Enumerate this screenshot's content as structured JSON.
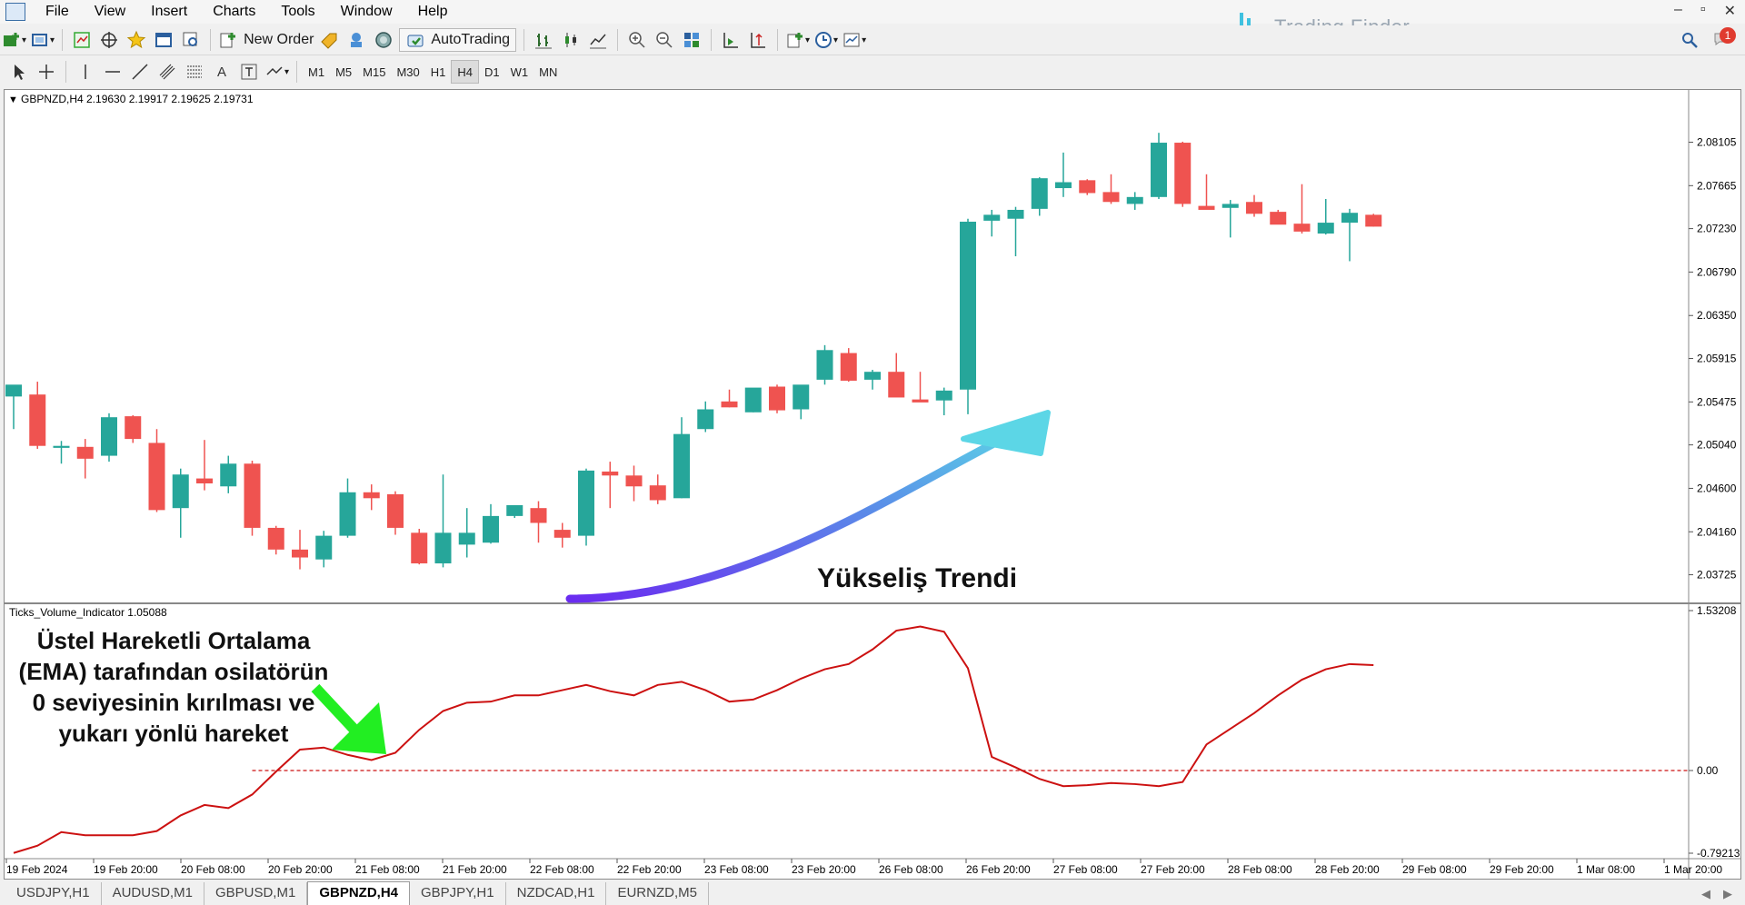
{
  "menu": [
    "File",
    "View",
    "Insert",
    "Charts",
    "Tools",
    "Window",
    "Help"
  ],
  "brand": {
    "name": "Trading Finder",
    "accent": "#3fc1e0"
  },
  "window_controls": [
    "–",
    "▫",
    "✕"
  ],
  "toolbar": {
    "new_order": "New Order",
    "autotrading": "AutoTrading",
    "timeframes": [
      "M1",
      "M5",
      "M15",
      "M30",
      "H1",
      "H4",
      "D1",
      "W1",
      "MN"
    ],
    "active_timeframe": "H4",
    "notification_count": "1"
  },
  "chart": {
    "header": "GBPNZD,H4  2.19630 2.19917 2.19625 2.19731",
    "indicator_header": "Ticks_Volume_Indicator 1.05088",
    "price_labels": [
      "2.08105",
      "2.07665",
      "2.07230",
      "2.06790",
      "2.06350",
      "2.05915",
      "2.05475",
      "2.05040",
      "2.04600",
      "2.04160",
      "2.03725"
    ],
    "indicator_labels": [
      "1.53208",
      "0.00",
      "-0.79213"
    ],
    "time_labels": [
      "19 Feb 2024",
      "19 Feb 20:00",
      "20 Feb 08:00",
      "20 Feb 20:00",
      "21 Feb 08:00",
      "21 Feb 20:00",
      "22 Feb 08:00",
      "22 Feb 20:00",
      "23 Feb 08:00",
      "23 Feb 20:00",
      "26 Feb 08:00",
      "26 Feb 20:00",
      "27 Feb 08:00",
      "27 Feb 20:00",
      "28 Feb 08:00",
      "28 Feb 20:00",
      "29 Feb 08:00",
      "29 Feb 20:00",
      "1 Mar 08:00",
      "1 Mar 20:00"
    ],
    "trend_label": "Yükseliş Trendi",
    "annotation_lines": [
      "Üstel Hareketli Ortalama",
      "(EMA) tarafından osilatörün",
      "0 seviyesinin kırılması ve",
      "yukarı yönlü hareket"
    ],
    "colors": {
      "bull": "#26a69a",
      "bear": "#ef5350",
      "indicator": "#cc1111",
      "zero_line": "#cc1111",
      "arrow_green": "#22ee22"
    }
  },
  "chart_data": [
    {
      "type": "candlestick",
      "symbol": "GBPNZD,H4",
      "ylim": [
        2.035,
        2.0845
      ],
      "candles": [
        {
          "o": 2.0553,
          "h": 2.0562,
          "l": 2.052,
          "c": 2.0565
        },
        {
          "o": 2.0555,
          "h": 2.0568,
          "l": 2.05,
          "c": 2.0503
        },
        {
          "o": 2.0501,
          "h": 2.0508,
          "l": 2.0485,
          "c": 2.0503
        },
        {
          "o": 2.0502,
          "h": 2.051,
          "l": 2.047,
          "c": 2.049
        },
        {
          "o": 2.0493,
          "h": 2.0536,
          "l": 2.0487,
          "c": 2.0532
        },
        {
          "o": 2.0533,
          "h": 2.0534,
          "l": 2.0506,
          "c": 2.051
        },
        {
          "o": 2.0506,
          "h": 2.052,
          "l": 2.0436,
          "c": 2.0438
        },
        {
          "o": 2.044,
          "h": 2.048,
          "l": 2.041,
          "c": 2.0474
        },
        {
          "o": 2.047,
          "h": 2.0509,
          "l": 2.0458,
          "c": 2.0465
        },
        {
          "o": 2.0462,
          "h": 2.0493,
          "l": 2.0455,
          "c": 2.0485
        },
        {
          "o": 2.0485,
          "h": 2.0488,
          "l": 2.0412,
          "c": 2.042
        },
        {
          "o": 2.042,
          "h": 2.0422,
          "l": 2.0393,
          "c": 2.0398
        },
        {
          "o": 2.0398,
          "h": 2.0418,
          "l": 2.0378,
          "c": 2.039
        },
        {
          "o": 2.0388,
          "h": 2.0417,
          "l": 2.038,
          "c": 2.0412
        },
        {
          "o": 2.0412,
          "h": 2.047,
          "l": 2.041,
          "c": 2.0456
        },
        {
          "o": 2.0456,
          "h": 2.0464,
          "l": 2.0438,
          "c": 2.045
        },
        {
          "o": 2.0454,
          "h": 2.0457,
          "l": 2.0413,
          "c": 2.042
        },
        {
          "o": 2.0415,
          "h": 2.0419,
          "l": 2.0383,
          "c": 2.0384
        },
        {
          "o": 2.0384,
          "h": 2.0474,
          "l": 2.038,
          "c": 2.0415
        },
        {
          "o": 2.0403,
          "h": 2.044,
          "l": 2.039,
          "c": 2.0415
        },
        {
          "o": 2.0405,
          "h": 2.0444,
          "l": 2.0404,
          "c": 2.0432
        },
        {
          "o": 2.0432,
          "h": 2.0442,
          "l": 2.043,
          "c": 2.0443
        },
        {
          "o": 2.044,
          "h": 2.0447,
          "l": 2.0405,
          "c": 2.0425
        },
        {
          "o": 2.0418,
          "h": 2.0425,
          "l": 2.04,
          "c": 2.041
        },
        {
          "o": 2.0412,
          "h": 2.048,
          "l": 2.0402,
          "c": 2.0478
        },
        {
          "o": 2.0477,
          "h": 2.0487,
          "l": 2.044,
          "c": 2.0473
        },
        {
          "o": 2.0473,
          "h": 2.0483,
          "l": 2.0447,
          "c": 2.0462
        },
        {
          "o": 2.0463,
          "h": 2.0474,
          "l": 2.0444,
          "c": 2.0448
        },
        {
          "o": 2.045,
          "h": 2.0532,
          "l": 2.045,
          "c": 2.0515
        },
        {
          "o": 2.052,
          "h": 2.0548,
          "l": 2.0517,
          "c": 2.054
        },
        {
          "o": 2.0548,
          "h": 2.056,
          "l": 2.0542,
          "c": 2.0542
        },
        {
          "o": 2.0537,
          "h": 2.056,
          "l": 2.0537,
          "c": 2.0562
        },
        {
          "o": 2.0563,
          "h": 2.0565,
          "l": 2.0536,
          "c": 2.0539
        },
        {
          "o": 2.054,
          "h": 2.0564,
          "l": 2.053,
          "c": 2.0565
        },
        {
          "o": 2.057,
          "h": 2.0605,
          "l": 2.0565,
          "c": 2.06
        },
        {
          "o": 2.0597,
          "h": 2.0602,
          "l": 2.0568,
          "c": 2.0569
        },
        {
          "o": 2.057,
          "h": 2.058,
          "l": 2.056,
          "c": 2.0578
        },
        {
          "o": 2.0578,
          "h": 2.0597,
          "l": 2.056,
          "c": 2.0552
        },
        {
          "o": 2.055,
          "h": 2.0578,
          "l": 2.0549,
          "c": 2.0547
        },
        {
          "o": 2.0549,
          "h": 2.0562,
          "l": 2.0534,
          "c": 2.0559
        },
        {
          "o": 2.056,
          "h": 2.0733,
          "l": 2.0535,
          "c": 2.073
        },
        {
          "o": 2.0731,
          "h": 2.0742,
          "l": 2.0715,
          "c": 2.0737
        },
        {
          "o": 2.0733,
          "h": 2.0745,
          "l": 2.0695,
          "c": 2.0742
        },
        {
          "o": 2.0743,
          "h": 2.0775,
          "l": 2.0736,
          "c": 2.0774
        },
        {
          "o": 2.0764,
          "h": 2.08,
          "l": 2.0755,
          "c": 2.077
        },
        {
          "o": 2.0772,
          "h": 2.0773,
          "l": 2.0757,
          "c": 2.0759
        },
        {
          "o": 2.076,
          "h": 2.0778,
          "l": 2.0748,
          "c": 2.075
        },
        {
          "o": 2.0748,
          "h": 2.076,
          "l": 2.0742,
          "c": 2.0755
        },
        {
          "o": 2.0755,
          "h": 2.082,
          "l": 2.0753,
          "c": 2.081
        },
        {
          "o": 2.081,
          "h": 2.0811,
          "l": 2.0745,
          "c": 2.0748
        },
        {
          "o": 2.0746,
          "h": 2.0778,
          "l": 2.0745,
          "c": 2.0742
        },
        {
          "o": 2.0744,
          "h": 2.0752,
          "l": 2.0714,
          "c": 2.0748
        },
        {
          "o": 2.075,
          "h": 2.0757,
          "l": 2.0735,
          "c": 2.0738
        },
        {
          "o": 2.074,
          "h": 2.0742,
          "l": 2.0728,
          "c": 2.0727
        },
        {
          "o": 2.0728,
          "h": 2.0768,
          "l": 2.0718,
          "c": 2.072
        },
        {
          "o": 2.0718,
          "h": 2.0753,
          "l": 2.0717,
          "c": 2.0729
        },
        {
          "o": 2.0729,
          "h": 2.0743,
          "l": 2.069,
          "c": 2.0739
        },
        {
          "o": 2.0737,
          "h": 2.0738,
          "l": 2.0725,
          "c": 2.0725
        }
      ]
    },
    {
      "type": "line",
      "name": "Ticks_Volume_Indicator 1.05088",
      "ylim": [
        -0.79213,
        1.53208
      ],
      "zero_line": 0.0,
      "values": [
        -0.79,
        -0.72,
        -0.59,
        -0.62,
        -0.62,
        -0.62,
        -0.58,
        -0.43,
        -0.33,
        -0.36,
        -0.23,
        -0.01,
        0.2,
        0.22,
        0.15,
        0.1,
        0.17,
        0.39,
        0.57,
        0.65,
        0.66,
        0.72,
        0.72,
        0.77,
        0.82,
        0.76,
        0.72,
        0.82,
        0.85,
        0.77,
        0.66,
        0.68,
        0.77,
        0.88,
        0.97,
        1.02,
        1.16,
        1.34,
        1.38,
        1.33,
        0.98,
        0.13,
        0.03,
        -0.08,
        -0.15,
        -0.14,
        -0.12,
        -0.13,
        -0.15,
        -0.11,
        0.25,
        0.4,
        0.55,
        0.72,
        0.87,
        0.97,
        1.02,
        1.01
      ]
    }
  ],
  "tabs": [
    "USDJPY,H1",
    "AUDUSD,M1",
    "GBPUSD,M1",
    "GBPNZD,H4",
    "GBPJPY,H1",
    "NZDCAD,H1",
    "EURNZD,M5"
  ],
  "active_tab": "GBPNZD,H4"
}
